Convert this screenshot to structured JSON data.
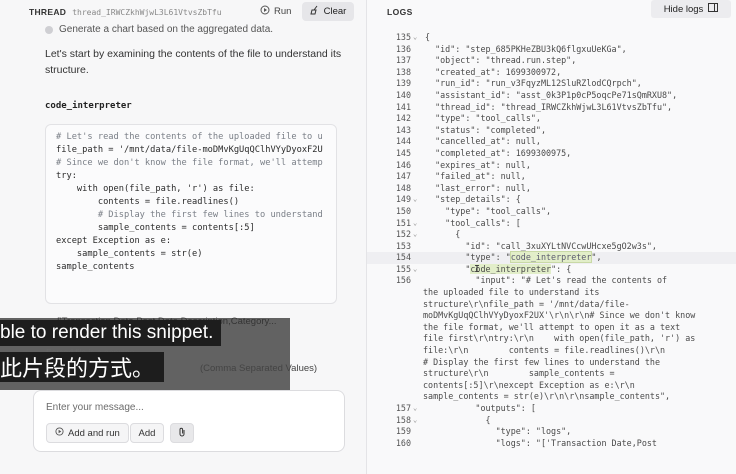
{
  "thread": {
    "label": "THREAD",
    "id": "thread_IRWCZkhWjwL3L61VtvsZbTfu",
    "run_label": "Run",
    "clear_label": "Clear"
  },
  "messages": {
    "step_text": "Generate a chart based on the aggregated data.",
    "intro": "Let's start by examining the contents of the file to understand its structure.",
    "code_interpreter_title": "code_interpreter",
    "code_lines": [
      "# Let's read the contents of the uploaded file to u",
      "file_path = '/mnt/data/file-moDMvKgUqQClhVYyDyoxF2U",
      "",
      "# Since we don't know the file format, we'll attemp",
      "try:",
      "    with open(file_path, 'r') as file:",
      "        contents = file.readlines()",
      "        # Display the first few lines to understand",
      "        sample_contents = contents[:5]",
      "except Exception as e:",
      "    sample_contents = str(e)",
      "",
      "sample_contents"
    ],
    "output_preview": "→ ['Transaction Date,Post Date,Description,Category...",
    "parsed_hint": "Parsed file is a genuine",
    "csv_hint": "(Comma Separated Values)"
  },
  "subtitles": {
    "en": "ble to render this snippet.",
    "zh": "此片段的方式。"
  },
  "composer": {
    "placeholder": "Enter your message...",
    "add_and_run": "Add and run",
    "add": "Add"
  },
  "logs": {
    "label": "LOGS",
    "hide_label": "Hide logs",
    "lines": [
      {
        "n": "135",
        "fold": "v",
        "t": "{"
      },
      {
        "n": "136",
        "t": "  \"id\": \"step_685PKHeZBU3kQ6flgxuUeKGa\","
      },
      {
        "n": "137",
        "t": "  \"object\": \"thread.run.step\","
      },
      {
        "n": "138",
        "t": "  \"created_at\": 1699300972,"
      },
      {
        "n": "139",
        "t": "  \"run_id\": \"run_v3FqyzML12SluRZlodCQrpch\","
      },
      {
        "n": "140",
        "t": "  \"assistant_id\": \"asst_0k3P1p0cP5oqcPe71sQmRXU8\","
      },
      {
        "n": "141",
        "t": "  \"thread_id\": \"thread_IRWCZkhWjwL3L61VtvsZbTfu\","
      },
      {
        "n": "142",
        "t": "  \"type\": \"tool_calls\","
      },
      {
        "n": "143",
        "t": "  \"status\": \"completed\","
      },
      {
        "n": "144",
        "t": "  \"cancelled_at\": null,"
      },
      {
        "n": "145",
        "t": "  \"completed_at\": 1699300975,"
      },
      {
        "n": "146",
        "t": "  \"expires_at\": null,"
      },
      {
        "n": "147",
        "t": "  \"failed_at\": null,"
      },
      {
        "n": "148",
        "t": "  \"last_error\": null,"
      },
      {
        "n": "149",
        "fold": "v",
        "t": "  \"step_details\": {"
      },
      {
        "n": "150",
        "t": "    \"type\": \"tool_calls\","
      },
      {
        "n": "151",
        "fold": "v",
        "t": "    \"tool_calls\": ["
      },
      {
        "n": "152",
        "fold": "v",
        "t": "      {"
      },
      {
        "n": "153",
        "t": "        \"id\": \"call_3xuXYLtNVCcwUHcxe5gO2w3s\","
      },
      {
        "n": "154",
        "t": "        \"type\": \"code_interpreter\",",
        "hl": true
      },
      {
        "n": "155",
        "fold": "v",
        "t": "        \"code_interpreter\": {"
      },
      {
        "n": "156",
        "t": "          \"input\": \"# Let's read the contents of"
      },
      {
        "n": "",
        "t": "the uploaded file to understand its"
      },
      {
        "n": "",
        "t": "structure\\r\\nfile_path = '/mnt/data/file-"
      },
      {
        "n": "",
        "t": "moDMvKgUqQClhVYyDyoxF2UX'\\r\\n\\r\\n# Since we don't know"
      },
      {
        "n": "",
        "t": "the file format, we'll attempt to open it as a text"
      },
      {
        "n": "",
        "t": "file first\\r\\ntry:\\r\\n    with open(file_path, 'r') as"
      },
      {
        "n": "",
        "t": "file:\\r\\n        contents = file.readlines()\\r\\n"
      },
      {
        "n": "",
        "t": "# Display the first few lines to understand the"
      },
      {
        "n": "",
        "t": "structure\\r\\n        sample_contents ="
      },
      {
        "n": "",
        "t": "contents[:5]\\r\\nexcept Exception as e:\\r\\n"
      },
      {
        "n": "",
        "t": "sample_contents = str(e)\\r\\n\\r\\nsample_contents\","
      },
      {
        "n": "157",
        "fold": "v",
        "t": "          \"outputs\": ["
      },
      {
        "n": "158",
        "fold": "v",
        "t": "            {"
      },
      {
        "n": "159",
        "t": "              \"type\": \"logs\","
      },
      {
        "n": "160",
        "t": "              \"logs\": \"['Transaction Date,Post"
      }
    ]
  },
  "colors": {
    "accent_highlight": "#e2eec9",
    "pane_bg": "#f7f7f8",
    "subtitle_bg": "#1d1d1d"
  }
}
